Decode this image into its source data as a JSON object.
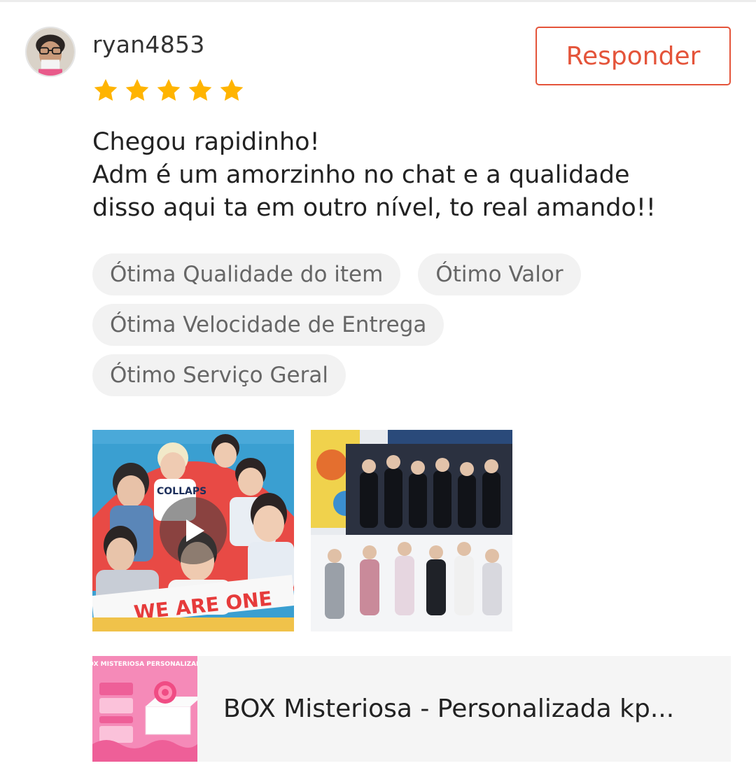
{
  "review": {
    "username": "ryan4853",
    "rating": 5,
    "reply_label": "Responder",
    "comment_lines": [
      "Chegou rapidinho!",
      "Adm é um amorzinho no chat e a qualidade",
      "disso aqui ta em outro nível, to real amando!!"
    ],
    "tags": [
      "Ótima Qualidade do item",
      "Ótimo Valor",
      "Ótima Velocidade de Entrega",
      "Ótimo Serviço Geral"
    ],
    "media_text": {
      "video_banner": "WE ARE ONE",
      "product_card_title": "BOX MISTERIOSA PERSONALIZADA"
    }
  },
  "product": {
    "name": "BOX Misteriosa - Personalizada kp..."
  },
  "colors": {
    "accent": "#e4543a",
    "star": "#ffb400",
    "tag_bg": "#f2f2f2",
    "product_bg": "#f5f5f5"
  },
  "icons": {
    "star": "star-icon",
    "play": "play-icon"
  }
}
